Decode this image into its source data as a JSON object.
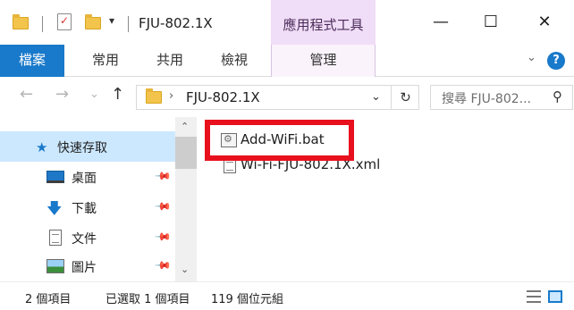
{
  "window": {
    "title": "FJU-802.1X",
    "context_group": "應用程式工具",
    "minimize": "—",
    "maximize": "☐",
    "close": "✕",
    "qat_dropdown": "▾"
  },
  "ribbon": {
    "tabs": [
      {
        "label": "檔案"
      },
      {
        "label": "常用"
      },
      {
        "label": "共用"
      },
      {
        "label": "檢視"
      },
      {
        "label": "管理"
      }
    ],
    "collapse": "⌄",
    "help": "?",
    "file_tab_color": "#1979ca",
    "context_color": "#f0ddf7"
  },
  "addressbar": {
    "back": "←",
    "forward": "→",
    "recent": "⌄",
    "up": "↑",
    "separator": "›",
    "crumb": "FJU-802.1X",
    "dropdown": "⌄",
    "refresh": "↻"
  },
  "search": {
    "placeholder": "搜尋 FJU-802...",
    "icon": "⚲"
  },
  "navpane": {
    "items": [
      {
        "label": "快速存取",
        "icon": "star-icon",
        "glyph": "★"
      },
      {
        "label": "桌面",
        "icon": "desktop-icon"
      },
      {
        "label": "下載",
        "icon": "download-icon",
        "glyph": "🡇"
      },
      {
        "label": "文件",
        "icon": "document-icon"
      },
      {
        "label": "圖片",
        "icon": "pictures-icon"
      }
    ],
    "pin": "📌",
    "scroll_up": "⌃",
    "scroll_down": "⌄"
  },
  "files": [
    {
      "name": "Add-WiFi.bat",
      "icon": "batch-file-icon",
      "highlighted": true
    },
    {
      "name": "Wi-Fi-FJU-802.1X.xml",
      "icon": "xml-file-icon",
      "highlighted": false
    }
  ],
  "statusbar": {
    "item_count": "2 個項目",
    "selection": "已選取 1 個項目",
    "size": "119 個位元組"
  },
  "colors": {
    "highlight": "#e8101d",
    "selection": "#cce8ff",
    "accent": "#1979ca"
  }
}
